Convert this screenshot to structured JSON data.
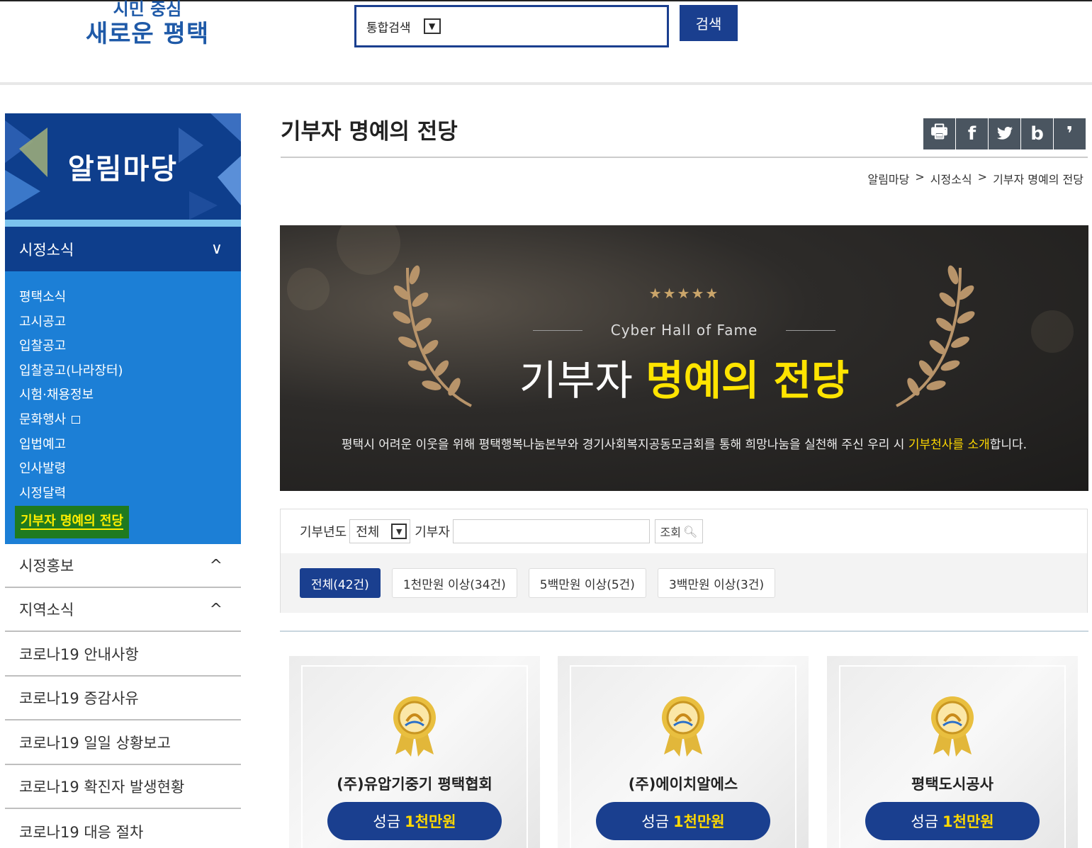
{
  "header": {
    "logo_line1": "시민 중심",
    "logo_line2": "새로운 평택",
    "search_scope": "통합검색",
    "search_button": "검색"
  },
  "sidebar": {
    "banner_title": "알림마당",
    "open_category": "시정소식",
    "sub_items": [
      {
        "label": "평택소식"
      },
      {
        "label": "고시공고"
      },
      {
        "label": "입찰공고"
      },
      {
        "label": "입찰공고(나라장터)"
      },
      {
        "label": "시험·채용정보"
      },
      {
        "label": "문화행사"
      },
      {
        "label": "입법예고"
      },
      {
        "label": "인사발령"
      },
      {
        "label": "시정달력"
      }
    ],
    "active_item": "기부자 명예의 전당",
    "categories": [
      {
        "label": "시정홍보",
        "chevron": "^"
      },
      {
        "label": "지역소식",
        "chevron": "^"
      },
      {
        "label": "코로나19 안내사항"
      },
      {
        "label": "코로나19 증감사유"
      },
      {
        "label": "코로나19 일일 상황보고"
      },
      {
        "label": "코로나19 확진자 발생현황"
      },
      {
        "label": "코로나19 대응 절차"
      }
    ]
  },
  "main": {
    "page_title": "기부자 명예의 전당",
    "share_icons": [
      "print-icon",
      "facebook-icon",
      "twitter-icon",
      "blog-icon",
      "kakao-icon"
    ],
    "breadcrumb": [
      "알림마당",
      ">",
      "시정소식",
      ">",
      "기부자 명예의 전당"
    ],
    "hero": {
      "stars": "★★★★★",
      "subtitle": "Cyber Hall of Fame",
      "title_white": "기부자",
      "title_yellow": "명예의 전당",
      "desc_prefix": "평택시 어려운 이웃을 위해 평택행복나눔본부와 경기사회복지공동모금회를 통해 희망나눔을 실천해 주신 우리 시 ",
      "desc_highlight": "기부천사를 소개",
      "desc_suffix": "합니다."
    },
    "filter": {
      "year_label": "기부년도",
      "year_value": "전체",
      "donor_label": "기부자",
      "donor_value": "",
      "search_button": "조회",
      "tabs": [
        "전체(42건)",
        "1천만원 이상(34건)",
        "5백만원 이상(5건)",
        "3백만원 이상(3건)"
      ]
    },
    "cards": [
      {
        "name": "(주)유압기중기 평택협회",
        "prefix": "성금",
        "amount": "1천만원"
      },
      {
        "name": "(주)에이치알에스",
        "prefix": "성금",
        "amount": "1천만원"
      },
      {
        "name": "평택도시공사",
        "prefix": "성금",
        "amount": "1천만원"
      }
    ],
    "colors": {
      "primary": "#1a3f8f",
      "accent": "#ffd800",
      "sidebar_sub": "#1c7fd6"
    }
  }
}
